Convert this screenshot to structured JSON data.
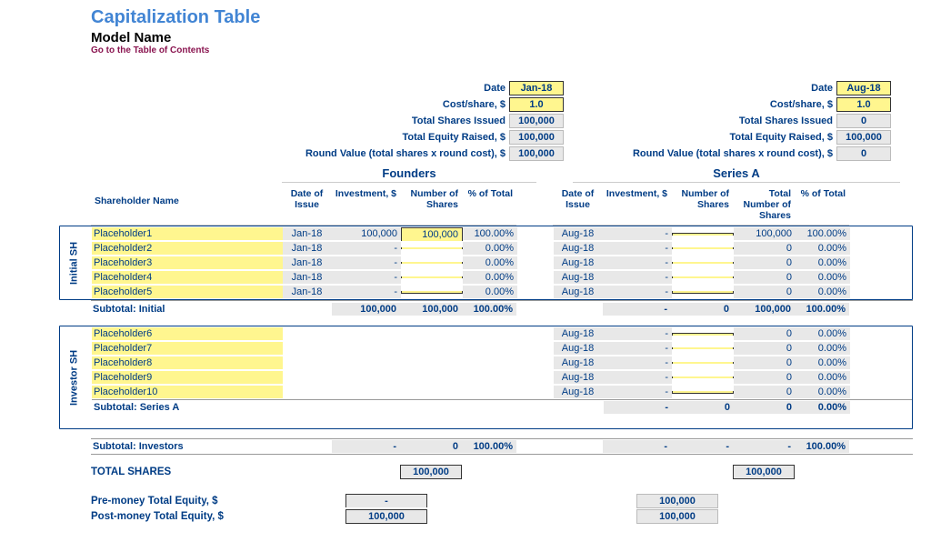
{
  "header": {
    "title": "Capitalization Table",
    "subtitle": "Model Name",
    "toc": "Go to the Table of Contents"
  },
  "roundLabels": {
    "date": "Date",
    "cost": "Cost/share, $",
    "totalShares": "Total Shares Issued",
    "totalEquity": "Total Equity Raised, $",
    "roundValue": "Round Value (total shares x round cost), $"
  },
  "founders": {
    "title": "Founders",
    "date": "Jan-18",
    "cost": "1.0",
    "totalShares": "100,000",
    "totalEquity": "100,000",
    "roundValue": "100,000"
  },
  "seriesA": {
    "title": "Series A",
    "date": "Aug-18",
    "cost": "1.0",
    "totalShares": "0",
    "totalEquity": "100,000",
    "roundValue": "0"
  },
  "columns": {
    "shareholder": "Shareholder Name",
    "dateOfIssue": "Date of Issue",
    "investment": "Investment, $",
    "numShares": "Number of Shares",
    "totNumShares": "Total Number of Shares",
    "pctTotal": "% of Total"
  },
  "groups": {
    "initial": {
      "label": "Initial SH",
      "subtotal": "Subtotal: Initial"
    },
    "investor": {
      "label": "Investor SH",
      "subtotal": "Subtotal: Series A"
    },
    "investorsAll": "Subtotal: Investors"
  },
  "initialRows": [
    {
      "name": "Placeholder1",
      "fDate": "Jan-18",
      "fInv": "100,000",
      "fShares": "100,000",
      "fPct": "100.00%",
      "aDate": "Aug-18",
      "aInv": "-",
      "aShares": "",
      "aTot": "100,000",
      "aPct": "100.00%"
    },
    {
      "name": "Placeholder2",
      "fDate": "Jan-18",
      "fInv": "-",
      "fShares": "",
      "fPct": "0.00%",
      "aDate": "Aug-18",
      "aInv": "-",
      "aShares": "",
      "aTot": "0",
      "aPct": "0.00%"
    },
    {
      "name": "Placeholder3",
      "fDate": "Jan-18",
      "fInv": "-",
      "fShares": "",
      "fPct": "0.00%",
      "aDate": "Aug-18",
      "aInv": "-",
      "aShares": "",
      "aTot": "0",
      "aPct": "0.00%"
    },
    {
      "name": "Placeholder4",
      "fDate": "Jan-18",
      "fInv": "-",
      "fShares": "",
      "fPct": "0.00%",
      "aDate": "Aug-18",
      "aInv": "-",
      "aShares": "",
      "aTot": "0",
      "aPct": "0.00%"
    },
    {
      "name": "Placeholder5",
      "fDate": "Jan-18",
      "fInv": "-",
      "fShares": "",
      "fPct": "0.00%",
      "aDate": "Aug-18",
      "aInv": "-",
      "aShares": "",
      "aTot": "0",
      "aPct": "0.00%"
    }
  ],
  "initialSubtotal": {
    "fInv": "100,000",
    "fShares": "100,000",
    "fPct": "100.00%",
    "aInv": "-",
    "aShares": "0",
    "aTot": "100,000",
    "aPct": "100.00%"
  },
  "investorRows": [
    {
      "name": "Placeholder6",
      "aDate": "Aug-18",
      "aInv": "-",
      "aShares": "",
      "aTot": "0",
      "aPct": "0.00%"
    },
    {
      "name": "Placeholder7",
      "aDate": "Aug-18",
      "aInv": "-",
      "aShares": "",
      "aTot": "0",
      "aPct": "0.00%"
    },
    {
      "name": "Placeholder8",
      "aDate": "Aug-18",
      "aInv": "-",
      "aShares": "",
      "aTot": "0",
      "aPct": "0.00%"
    },
    {
      "name": "Placeholder9",
      "aDate": "Aug-18",
      "aInv": "-",
      "aShares": "",
      "aTot": "0",
      "aPct": "0.00%"
    },
    {
      "name": "Placeholder10",
      "aDate": "Aug-18",
      "aInv": "-",
      "aShares": "",
      "aTot": "0",
      "aPct": "0.00%"
    }
  ],
  "investorSubtotal": {
    "aInv": "-",
    "aShares": "0",
    "aTot": "0",
    "aPct": "0.00%"
  },
  "investorsAll": {
    "fInv": "-",
    "fShares": "0",
    "fPct": "100.00%",
    "aInv": "-",
    "aShares": "-",
    "aTot": "-",
    "aPct": "100.00%"
  },
  "totals": {
    "label": "TOTAL SHARES",
    "founders": "100,000",
    "seriesA": "100,000"
  },
  "equity": {
    "preLabel": "Pre-money Total Equity, $",
    "postLabel": "Post-money Total Equity, $",
    "preF": "-",
    "postF": "100,000",
    "preA": "100,000",
    "postA": "100,000"
  }
}
